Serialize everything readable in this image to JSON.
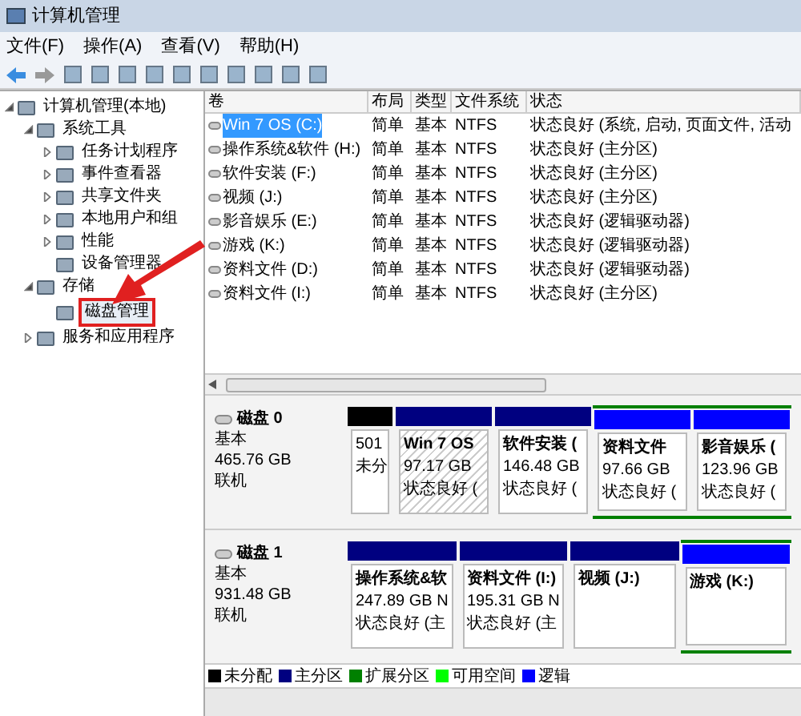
{
  "window": {
    "title": "计算机管理"
  },
  "menu": [
    "文件(F)",
    "操作(A)",
    "查看(V)",
    "帮助(H)"
  ],
  "tree": [
    {
      "label": "计算机管理(本地)",
      "expanded": true,
      "selected": false,
      "children": [
        {
          "label": "系统工具",
          "expanded": true,
          "selected": false,
          "children": [
            {
              "label": "任务计划程序",
              "expanded": false,
              "selected": false
            },
            {
              "label": "事件查看器",
              "expanded": false,
              "selected": false
            },
            {
              "label": "共享文件夹",
              "expanded": false,
              "selected": false
            },
            {
              "label": "本地用户和组",
              "expanded": false,
              "selected": false
            },
            {
              "label": "性能",
              "expanded": false,
              "selected": false
            },
            {
              "label": "设备管理器",
              "selected": false
            }
          ]
        },
        {
          "label": "存储",
          "expanded": true,
          "selected": false,
          "children": [
            {
              "label": "磁盘管理",
              "selected": true
            }
          ]
        },
        {
          "label": "服务和应用程序",
          "expanded": false,
          "selected": false
        }
      ]
    }
  ],
  "table": {
    "columns": [
      "卷",
      "布局",
      "类型",
      "文件系统",
      "状态"
    ],
    "rows": [
      {
        "cells": [
          "Win 7 OS  (C:)",
          "简单",
          "基本",
          "NTFS",
          "状态良好 (系统, 启动, 页面文件, 活动"
        ],
        "selected": true
      },
      {
        "cells": [
          "操作系统&软件 (H:)",
          "简单",
          "基本",
          "NTFS",
          "状态良好 (主分区)"
        ],
        "selected": false
      },
      {
        "cells": [
          "软件安装 (F:)",
          "简单",
          "基本",
          "NTFS",
          "状态良好 (主分区)"
        ],
        "selected": false
      },
      {
        "cells": [
          "视频 (J:)",
          "简单",
          "基本",
          "NTFS",
          "状态良好 (主分区)"
        ],
        "selected": false
      },
      {
        "cells": [
          "影音娱乐 (E:)",
          "简单",
          "基本",
          "NTFS",
          "状态良好 (逻辑驱动器)"
        ],
        "selected": false
      },
      {
        "cells": [
          "游戏 (K:)",
          "简单",
          "基本",
          "NTFS",
          "状态良好 (逻辑驱动器)"
        ],
        "selected": false
      },
      {
        "cells": [
          "资料文件 (D:)",
          "简单",
          "基本",
          "NTFS",
          "状态良好 (逻辑驱动器)"
        ],
        "selected": false
      },
      {
        "cells": [
          "资料文件 (I:)",
          "简单",
          "基本",
          "NTFS",
          "状态良好 (主分区)"
        ],
        "selected": false
      }
    ]
  },
  "disks": [
    {
      "name": "磁盘 0",
      "type": "基本",
      "size": "465.76 GB",
      "status": "联机",
      "partitions": [
        {
          "kind": "unallocated",
          "size": "501",
          "status": "未分",
          "selected": false,
          "extended": false
        },
        {
          "kind": "primary",
          "title": "Win 7 OS",
          "size": "97.17 GB",
          "status": "状态良好 (",
          "selected": true,
          "extended": false
        },
        {
          "kind": "primary",
          "title": "软件安装 (",
          "size": "146.48 GB",
          "status": "状态良好 (",
          "selected": false,
          "extended": false
        },
        {
          "kind": "logical",
          "title": "资料文件",
          "size": "97.66 GB",
          "status": "状态良好 (",
          "selected": false,
          "extended": true
        },
        {
          "kind": "logical",
          "title": "影音娱乐 (",
          "size": "123.96 GB",
          "status": "状态良好 (",
          "selected": false,
          "extended": true
        }
      ]
    },
    {
      "name": "磁盘 1",
      "type": "基本",
      "size": "931.48 GB",
      "status": "联机",
      "partitions": [
        {
          "kind": "primary",
          "title": "操作系统&软",
          "size": "247.89 GB N",
          "status": "状态良好 (主",
          "selected": false,
          "extended": false
        },
        {
          "kind": "primary",
          "title": "资料文件 (I:)",
          "size": "195.31 GB N",
          "status": "状态良好 (主",
          "selected": false,
          "extended": false
        },
        {
          "kind": "primary",
          "title": "视频 (J:)",
          "selected": false,
          "extended": false
        },
        {
          "kind": "logical",
          "title": "游戏 (K:)",
          "selected": false,
          "extended": true
        }
      ]
    }
  ],
  "legend": [
    {
      "label": "未分配",
      "color": "#000000"
    },
    {
      "label": "主分区",
      "color": "#000080"
    },
    {
      "label": "扩展分区",
      "color": "#008000"
    },
    {
      "label": "可用空间",
      "color": "#00ff00"
    },
    {
      "label": "逻辑",
      "color": "#0000ff"
    }
  ]
}
